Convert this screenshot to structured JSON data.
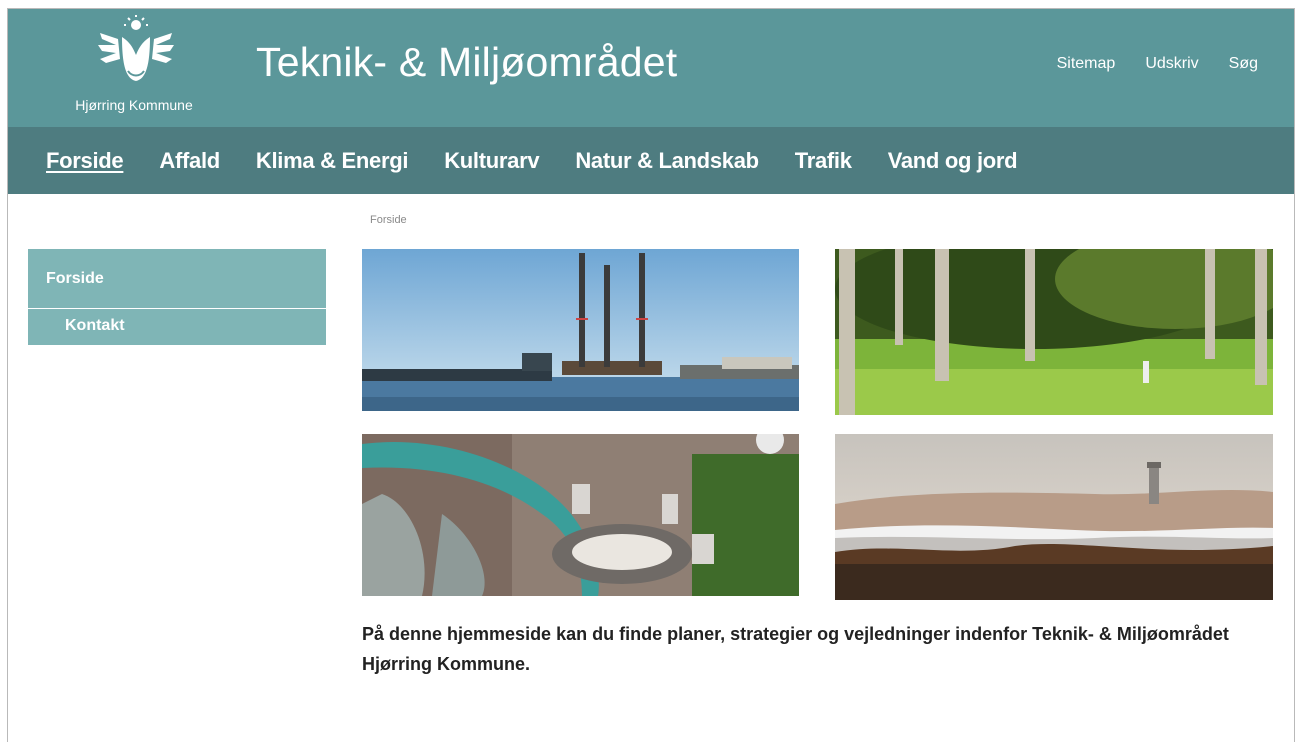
{
  "header": {
    "logo_text": "Hjørring Kommune",
    "title": "Teknik- & Miljøområdet",
    "links": [
      "Sitemap",
      "Udskriv",
      "Søg"
    ]
  },
  "nav": {
    "items": [
      "Forside",
      "Affald",
      "Klima & Energi",
      "Kulturarv",
      "Natur & Landskab",
      "Trafik",
      "Vand og jord"
    ],
    "active": "Forside"
  },
  "breadcrumb": "Forside",
  "sidemenu": {
    "items": [
      "Forside",
      "Kontakt"
    ]
  },
  "content": {
    "intro": "På denne hjemmeside kan du finde planer, strategier og vejledninger indenfor Teknik- & Miljøområdet Hjørring Kommune."
  },
  "colors": {
    "header_bg": "#5b979a",
    "nav_bg": "#4e7c80",
    "sidemenu_bg": "#7fb5b6"
  }
}
